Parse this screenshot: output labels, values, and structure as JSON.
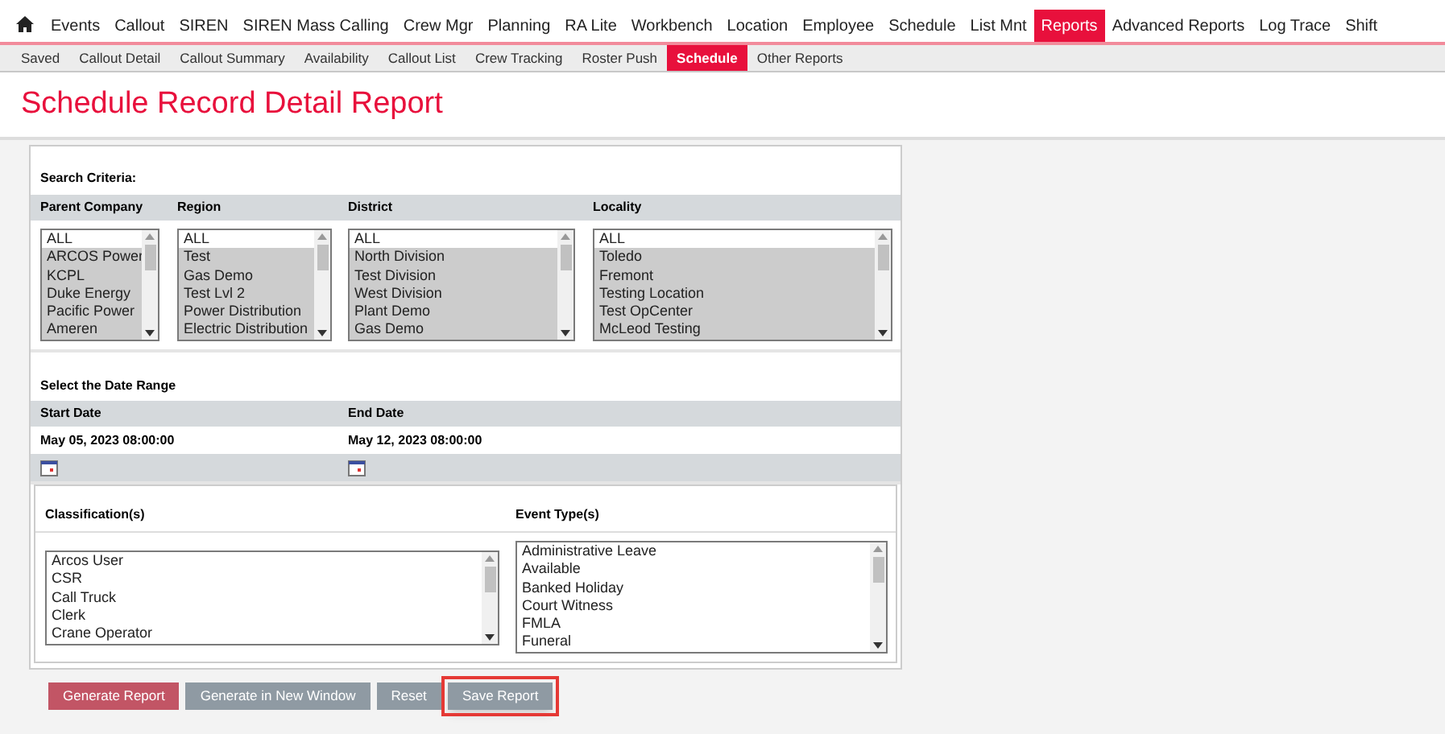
{
  "main_nav": [
    {
      "label": "Events",
      "selected": false
    },
    {
      "label": "Callout",
      "selected": false
    },
    {
      "label": "SIREN",
      "selected": false
    },
    {
      "label": "SIREN Mass Calling",
      "selected": false
    },
    {
      "label": "Crew Mgr",
      "selected": false
    },
    {
      "label": "Planning",
      "selected": false
    },
    {
      "label": "RA Lite",
      "selected": false
    },
    {
      "label": "Workbench",
      "selected": false
    },
    {
      "label": "Location",
      "selected": false
    },
    {
      "label": "Employee",
      "selected": false
    },
    {
      "label": "Schedule",
      "selected": false
    },
    {
      "label": "List Mnt",
      "selected": false
    },
    {
      "label": "Reports",
      "selected": true
    },
    {
      "label": "Advanced Reports",
      "selected": false
    },
    {
      "label": "Log Trace",
      "selected": false
    },
    {
      "label": "Shift",
      "selected": false
    }
  ],
  "sub_nav": [
    {
      "label": "Saved",
      "selected": false
    },
    {
      "label": "Callout Detail",
      "selected": false
    },
    {
      "label": "Callout Summary",
      "selected": false
    },
    {
      "label": "Availability",
      "selected": false
    },
    {
      "label": "Callout List",
      "selected": false
    },
    {
      "label": "Crew Tracking",
      "selected": false
    },
    {
      "label": "Roster Push",
      "selected": false
    },
    {
      "label": "Schedule",
      "selected": true
    },
    {
      "label": "Other Reports",
      "selected": false
    }
  ],
  "page_title": "Schedule Record Detail Report",
  "search_criteria": {
    "heading": "Search Criteria:",
    "filters": [
      {
        "label": "Parent Company",
        "items": [
          {
            "label": "ALL",
            "selected": false
          },
          {
            "label": "ARCOS Power",
            "selected": true
          },
          {
            "label": "KCPL",
            "selected": true
          },
          {
            "label": "Duke Energy",
            "selected": true
          },
          {
            "label": "Pacific Power",
            "selected": true
          },
          {
            "label": "Ameren",
            "selected": true
          }
        ]
      },
      {
        "label": "Region",
        "items": [
          {
            "label": "ALL",
            "selected": false
          },
          {
            "label": "Test",
            "selected": true
          },
          {
            "label": "Gas Demo",
            "selected": true
          },
          {
            "label": "Test Lvl 2",
            "selected": true
          },
          {
            "label": "Power Distribution",
            "selected": true
          },
          {
            "label": "Electric Distribution",
            "selected": true
          }
        ]
      },
      {
        "label": "District",
        "items": [
          {
            "label": "ALL",
            "selected": false
          },
          {
            "label": "North Division",
            "selected": true
          },
          {
            "label": "Test Division",
            "selected": true
          },
          {
            "label": "West Division",
            "selected": true
          },
          {
            "label": "Plant Demo",
            "selected": true
          },
          {
            "label": "Gas Demo",
            "selected": true
          }
        ]
      },
      {
        "label": "Locality",
        "items": [
          {
            "label": "ALL",
            "selected": false
          },
          {
            "label": "Toledo",
            "selected": true
          },
          {
            "label": "Fremont",
            "selected": true
          },
          {
            "label": "Testing Location",
            "selected": true
          },
          {
            "label": "Test OpCenter",
            "selected": true
          },
          {
            "label": "McLeod Testing",
            "selected": true
          }
        ]
      }
    ]
  },
  "date_range": {
    "heading": "Select the Date Range",
    "start": {
      "label": "Start Date",
      "value": "May 05, 2023 08:00:00"
    },
    "end": {
      "label": "End Date",
      "value": "May 12, 2023 08:00:00"
    }
  },
  "classifications": {
    "label": "Classification(s)",
    "items": [
      {
        "label": "Arcos User",
        "selected": false
      },
      {
        "label": "CSR",
        "selected": false
      },
      {
        "label": "Call Truck",
        "selected": false
      },
      {
        "label": "Clerk",
        "selected": false
      },
      {
        "label": "Crane Operator",
        "selected": false
      }
    ]
  },
  "event_types": {
    "label": "Event Type(s)",
    "items": [
      {
        "label": "Administrative Leave",
        "selected": false
      },
      {
        "label": "Available",
        "selected": false
      },
      {
        "label": "Banked Holiday",
        "selected": false
      },
      {
        "label": "Court Witness",
        "selected": false
      },
      {
        "label": "FMLA",
        "selected": false
      },
      {
        "label": "Funeral",
        "selected": false
      }
    ]
  },
  "buttons": [
    {
      "label": "Generate Report",
      "kind": "primary",
      "highlighted": false
    },
    {
      "label": "Generate in New Window",
      "kind": "secondary",
      "highlighted": false
    },
    {
      "label": "Reset",
      "kind": "secondary",
      "highlighted": false
    },
    {
      "label": "Save Report",
      "kind": "secondary",
      "highlighted": true
    }
  ]
}
